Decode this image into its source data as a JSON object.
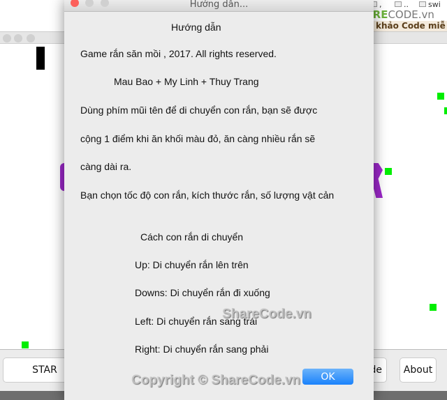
{
  "browser": {
    "bookmarks": [
      ",",
      "..",
      "swi"
    ],
    "nav": "khảo  Code miễ",
    "logo": {
      "brand": "SHARE",
      "suffix": "CODE.vn"
    }
  },
  "game": {
    "buttons": {
      "start": "STAR",
      "mode": "de",
      "about": "About"
    },
    "colors": {
      "food": "#00ee00",
      "snake": "#000000",
      "letters": "#9b27c9"
    }
  },
  "dialog": {
    "window_title": "Hướng dẫn...",
    "lines": [
      "Hướng dẫn",
      "Game rắn săn mồi , 2017. All rights reserved.",
      "Mau Bao + My Linh + Thuy Trang",
      " Dùng phím mũi tên để di chuyển con rắn, bạn sẽ được",
      "cộng 1 điểm khi ăn khối màu đỏ, ăn càng nhiều rắn sẽ",
      "càng dài ra.",
      "Bạn chọn tốc độ con rắn, kích thước rắn, số lượng vật cản",
      "Cách con rắn di chuyển",
      "Up: Di chuyển rắn lên trên",
      "Downs: Di chuyển rắn đi xuống",
      "Left: Di chuyển rắn sang trái",
      "Right: Di chuyển rắn sang phải"
    ],
    "ok_label": "OK"
  },
  "watermarks": {
    "center": "ShareCode.vn",
    "bottom": "Copyright © ShareCode.vn"
  }
}
